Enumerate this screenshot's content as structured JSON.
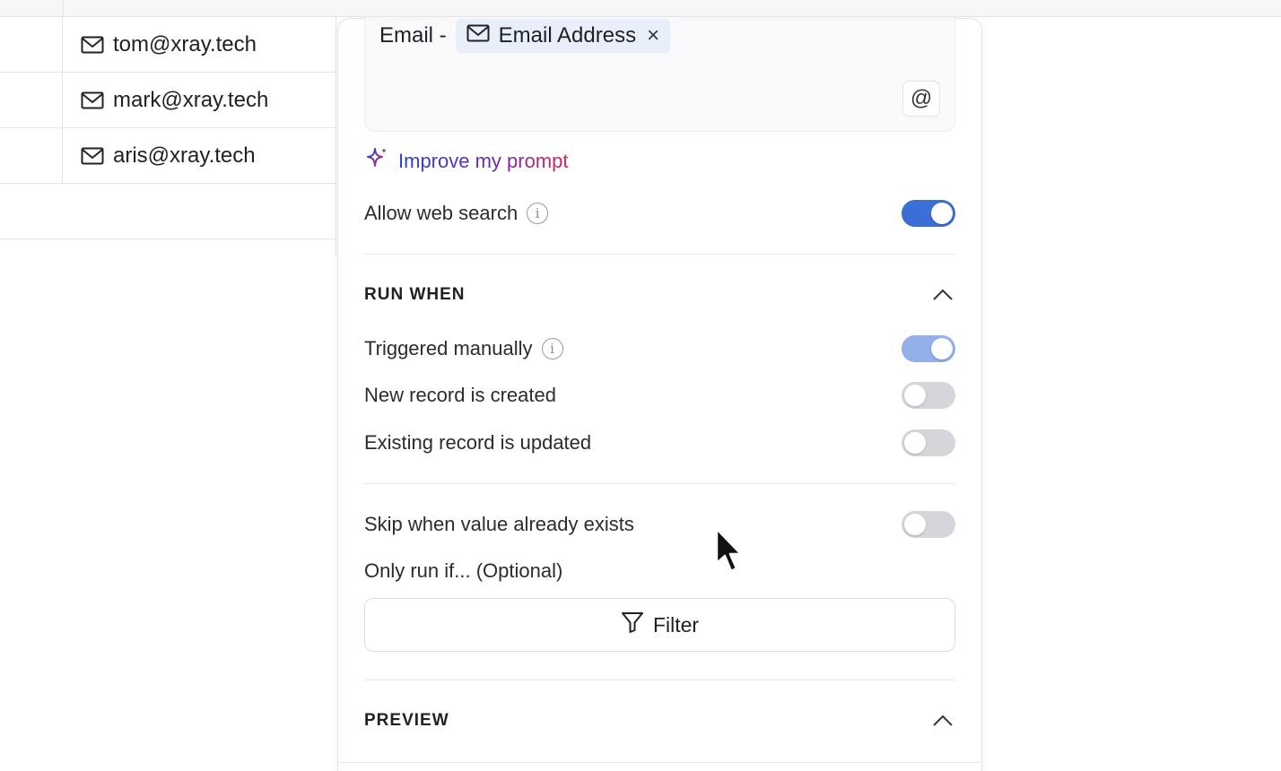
{
  "table": {
    "rows": [
      {
        "email": "tom@xray.tech"
      },
      {
        "email": "mark@xray.tech"
      },
      {
        "email": "aris@xray.tech"
      },
      {
        "email": ""
      }
    ]
  },
  "prompt": {
    "prefix": "Email -",
    "chip_label": "Email Address",
    "chip_close": "×",
    "at_symbol": "@"
  },
  "improve_prompt": {
    "label": "Improve my prompt",
    "icon": "sparkle-icon"
  },
  "web_search": {
    "label": "Allow web search",
    "enabled": true
  },
  "run_when": {
    "title": "RUN WHEN",
    "options": [
      {
        "label": "Triggered manually",
        "enabled": true,
        "has_info": true
      },
      {
        "label": "New record is created",
        "enabled": false,
        "has_info": false
      },
      {
        "label": "Existing record is updated",
        "enabled": false,
        "has_info": false
      }
    ]
  },
  "skip": {
    "label": "Skip when value already exists",
    "enabled": false
  },
  "only_run": {
    "label": "Only run if... (Optional)"
  },
  "filter": {
    "label": "Filter",
    "icon": "filter-icon"
  },
  "preview": {
    "title": "PREVIEW"
  },
  "colors": {
    "toggle_on": "#3b6fd6",
    "toggle_on_light": "#93b0ea",
    "toggle_off": "#d6d6da",
    "chip_bg": "#e9eefb"
  }
}
